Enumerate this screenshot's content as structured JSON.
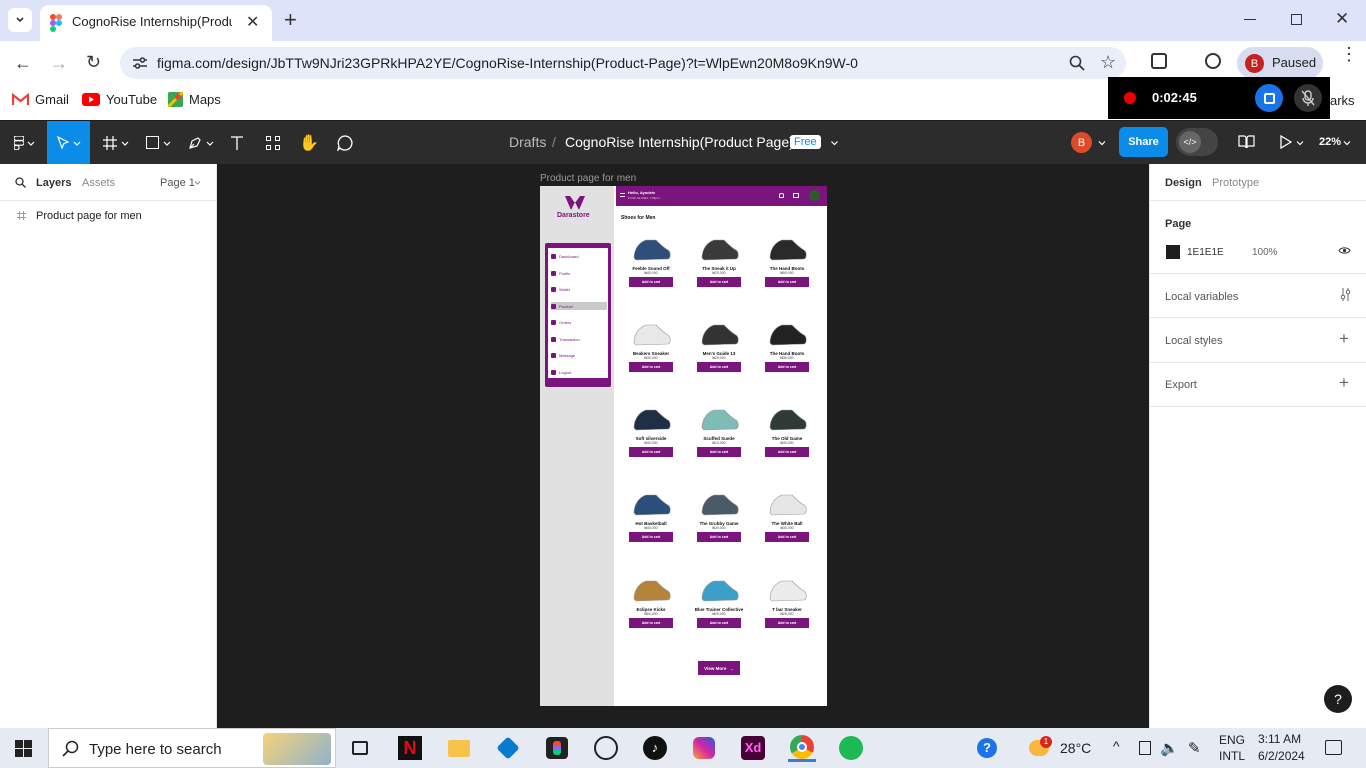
{
  "browser": {
    "tab_title": "CognoRise Internship(Product",
    "new_tab_label": "+",
    "url": "figma.com/design/JbTTw9NJri23GPRkHPA2YE/CognoRise-Internship(Product-Page)?t=WlpEwn20M8o9Kn9W-0",
    "profile_initial": "B",
    "profile_status": "Paused",
    "bookmarks": [
      "Gmail",
      "YouTube",
      "Maps"
    ],
    "bookmarks_overflow": "arks"
  },
  "recorder": {
    "time": "0:02:45"
  },
  "figma": {
    "breadcrumb_root": "Drafts",
    "breadcrumb_sep": "/",
    "file_name": "CognoRise Internship(Product Page)",
    "plan_badge": "Free",
    "user_initial": "B",
    "share_label": "Share",
    "zoom": "22%",
    "left_panel": {
      "tabs": [
        "Layers",
        "Assets"
      ],
      "page_selector": "Page 1",
      "layers": [
        "Product page for men"
      ]
    },
    "right_panel": {
      "tabs": [
        "Design",
        "Prototype"
      ],
      "page_heading": "Page",
      "page_color": "1E1E1E",
      "page_opacity": "100%",
      "sections": [
        "Local variables",
        "Local styles",
        "Export"
      ]
    },
    "frame_label": "Product page for men",
    "help": "?"
  },
  "design": {
    "brand": "Darastore",
    "greeting": "Hello, Ayodele",
    "greeting_sub": "Fri 02 Jul 2024, 7:35pm",
    "section_title": "Shoes for Men",
    "menu": [
      "Dashboard",
      "Profile",
      "Wallet",
      "Product",
      "Orders",
      "Transaction",
      "Message",
      "Logout"
    ],
    "active_menu": "Product",
    "add_to_cart": "Add to cart",
    "view_more": "View More",
    "products": [
      {
        "name": "Feeble Sound Off",
        "price": "₦40,000"
      },
      {
        "name": "The Sneak it Up",
        "price": "₦20,000"
      },
      {
        "name": "The Hand Boots",
        "price": "₦50,000"
      },
      {
        "name": "Beakers Sneaker",
        "price": "₦30,000"
      },
      {
        "name": "Men's Guide 13",
        "price": "₦25,000"
      },
      {
        "name": "The Hand Boots",
        "price": "₦35,000"
      },
      {
        "name": "Soft silverside",
        "price": "₦40,000"
      },
      {
        "name": "Scuffed Suede",
        "price": "₦15,000"
      },
      {
        "name": "The Old Game",
        "price": "₦30,000"
      },
      {
        "name": "Hot Basketball",
        "price": "₦40,000"
      },
      {
        "name": "The Grubby Game",
        "price": "₦20,000"
      },
      {
        "name": "The White Ball",
        "price": "₦30,000"
      },
      {
        "name": "Eclipse Kicks",
        "price": "₦50,000"
      },
      {
        "name": "Blue Trainer Collective",
        "price": "₦20,000"
      },
      {
        "name": "T bar Sneaker",
        "price": "₦25,000"
      }
    ]
  },
  "taskbar": {
    "search_placeholder": "Type here to search",
    "weather": "28°C",
    "weather_badge": "1",
    "lang": "ENG",
    "lang_sub": "INTL",
    "time": "3:11 AM",
    "date": "6/2/2024"
  }
}
